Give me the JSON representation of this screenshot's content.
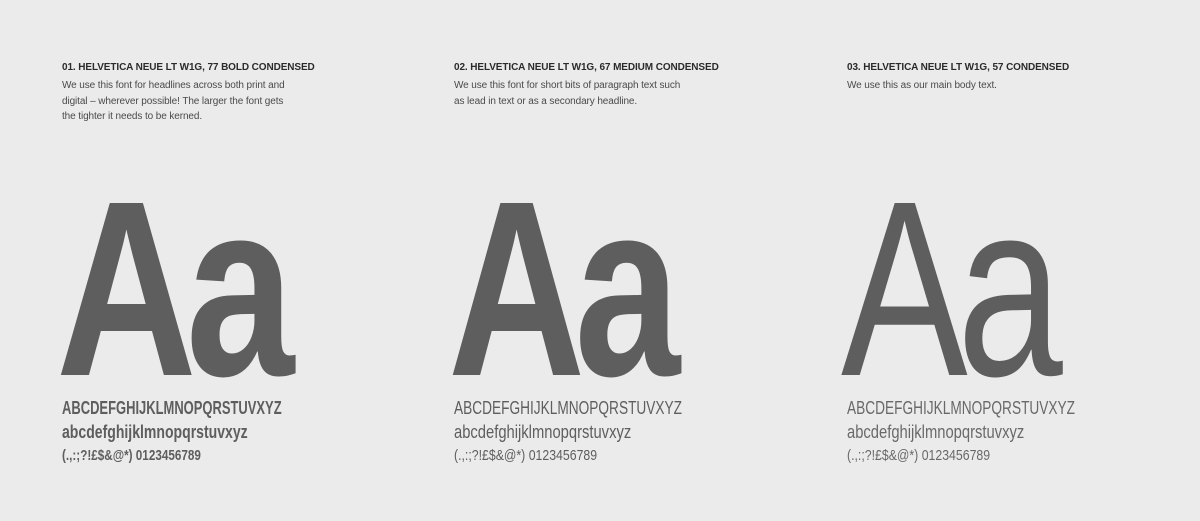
{
  "fonts": [
    {
      "title": "01. HELVETICA NEUE LT W1G, 77 BOLD CONDENSED",
      "description": "We use this font for headlines across both print and digital – wherever possible! The larger the font gets the tighter it needs to be kerned.",
      "specimen": "Aa",
      "uppercase": "ABCDEFGHIJKLMNOPQRSTUVXYZ",
      "lowercase": "abcdefghijklmnopqrstuvxyz",
      "symbols": "(.,:;?!£$&@*) 0123456789"
    },
    {
      "title": "02. HELVETICA NEUE LT W1G, 67 MEDIUM CONDENSED",
      "description": "We use this font for short bits of paragraph text such as lead in text or as a secondary headline.",
      "specimen": "Aa",
      "uppercase": "ABCDEFGHIJKLMNOPQRSTUVXYZ",
      "lowercase": "abcdefghijklmnopqrstuvxyz",
      "symbols": "(.,:;?!£$&@*) 0123456789"
    },
    {
      "title": "03. HELVETICA NEUE LT W1G, 57 CONDENSED",
      "description": "We use this as our main body text.",
      "specimen": "Aa",
      "uppercase": "ABCDEFGHIJKLMNOPQRSTUVXYZ",
      "lowercase": "abcdefghijklmnopqrstuvxyz",
      "symbols": "(.,:;?!£$&@*) 0123456789"
    }
  ],
  "colors": {
    "background": "#ebebeb",
    "specimen": "#5f5e5e",
    "title": "#2b2b2b"
  }
}
